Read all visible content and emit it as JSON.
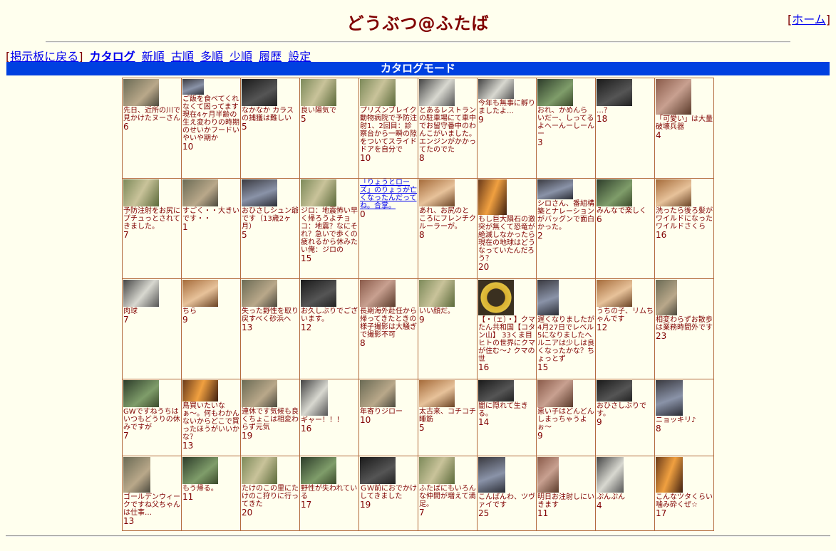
{
  "header": {
    "title": "どうぶつ@ふたば",
    "home_label": "ホーム",
    "bracket_open": "[",
    "bracket_close": "]"
  },
  "nav": {
    "back_label": "掲示板に戻る",
    "bracket_open": "[",
    "bracket_close": "]",
    "current": "カタログ",
    "links": [
      "新順",
      "古順",
      "多順",
      "少順",
      "履歴",
      "設定"
    ]
  },
  "mode_bar": {
    "label": "カタログモード"
  },
  "catalog": {
    "rows": [
      [
        {
          "thumb": [
            50,
            38
          ],
          "style": "t-a",
          "caption": "先日、近所の川で見かけたヌーさん",
          "count": "6"
        },
        {
          "thumb": [
            30,
            22
          ],
          "style": "t-b",
          "caption": "ご飯を食べてくれなくて困ってます現在4ヶ月半齢の生え変わりの時期のせいかフードいやいや期か",
          "count": "10"
        },
        {
          "thumb": [
            50,
            38
          ],
          "style": "t-h",
          "caption": "なかなか カラスの捕獲は難しい",
          "count": "5"
        },
        {
          "thumb": [
            50,
            38
          ],
          "style": "t-c",
          "caption": "良い陽気で",
          "count": "5"
        },
        {
          "thumb": [
            50,
            38
          ],
          "style": "t-c",
          "caption": "プリズンブレイク動物病院で予防注射1、2回目：診察台から一瞬の隙をついてスライドドアを自分で",
          "count": "10"
        },
        {
          "thumb": [
            50,
            38
          ],
          "style": "t-f",
          "caption": "とあるレストランの駐車場にて車中でお留守番中のわんこがいました。エンジンがかかってたのでた",
          "count": "8"
        },
        {
          "thumb": [
            50,
            28
          ],
          "style": "t-f",
          "caption": "今年も無事に孵りましたよ…",
          "count": "9"
        },
        {
          "thumb": [
            50,
            38
          ],
          "style": "t-e",
          "caption": "おれ、かめんらいだー、しってるよへーんーしーんー",
          "count": "3"
        },
        {
          "thumb": [
            50,
            38
          ],
          "style": "t-h",
          "caption": "…？",
          "count": "18"
        },
        {
          "thumb": [
            50,
            50
          ],
          "style": "t-j",
          "caption": "「可愛い」は大量破壊兵器",
          "count": "4"
        }
      ],
      [
        {
          "thumb": [
            50,
            38
          ],
          "style": "t-c",
          "caption": "予防注射をお尻にプチュっとされてきました。",
          "count": "7"
        },
        {
          "thumb": [
            50,
            38
          ],
          "style": "t-a",
          "caption": "すごく・・大きいです・・",
          "count": "1"
        },
        {
          "thumb": [
            50,
            38
          ],
          "style": "t-b",
          "caption": "おひさしシュン爺です（13歳2ヶ月）",
          "count": "5"
        },
        {
          "thumb": [
            50,
            38
          ],
          "style": "t-c",
          "caption": "ジロ：地震怖い早く帰ろうよチョコ：地震？なにそれ？急いで歩くの疲れるから休みたい俺：ジロの",
          "count": "15"
        },
        {
          "thumb": [
            0,
            0
          ],
          "style": "",
          "caption": "「りょうとローズ」のりょうが亡くなったんだってね。合掌。",
          "count": "0",
          "link": true
        },
        {
          "thumb": [
            50,
            38
          ],
          "style": "t-d",
          "caption": "あれ、お尻のところにフレンチクルーラーが。",
          "count": "8"
        },
        {
          "thumb": [
            40,
            50
          ],
          "style": "t-g",
          "caption": "もし巨大隕石の激突が無くて恐竜が絶滅しなかったら現在の地球はどうなっていたんだろう？",
          "count": "20"
        },
        {
          "thumb": [
            50,
            28
          ],
          "style": "t-b",
          "caption": "シロさん、番組構築とナレーションがバッグンで面白かった。",
          "count": "2"
        },
        {
          "thumb": [
            50,
            38
          ],
          "style": "t-e",
          "caption": "みんなで楽しく",
          "count": "6"
        },
        {
          "thumb": [
            50,
            38
          ],
          "style": "t-d",
          "caption": "洗ったら後ろ髪がワイルドになったワイルドさくら",
          "count": "16"
        }
      ],
      [
        {
          "thumb": [
            50,
            38
          ],
          "style": "t-f",
          "caption": "肉球",
          "count": "7"
        },
        {
          "thumb": [
            50,
            38
          ],
          "style": "t-d",
          "caption": "ちら",
          "count": "9"
        },
        {
          "thumb": [
            50,
            38
          ],
          "style": "t-a",
          "caption": "失った野性を取り戻すべく砂浜へ",
          "count": "13"
        },
        {
          "thumb": [
            50,
            38
          ],
          "style": "t-h",
          "caption": "お久しぶりでございます。",
          "count": "12"
        },
        {
          "thumb": [
            50,
            38
          ],
          "style": "t-j",
          "caption": "長期海外赴任から帰ってきたときの様子撮影は大騒ぎで撮影不可",
          "count": "8"
        },
        {
          "thumb": [
            50,
            38
          ],
          "style": "t-c",
          "caption": "いい顔だ。",
          "count": "9"
        },
        {
          "thumb": [
            50,
            50
          ],
          "style": "t-i",
          "caption": "【・（ェ）・】クマたん共和国【コタン山】 33くま目ヒトの世界にクマが住む〜♪ クマの世",
          "count": "16"
        },
        {
          "thumb": [
            30,
            50
          ],
          "style": "t-b",
          "caption": "遅くなりましたが4月27日でレベル5になりましたヘルニアは少しは良くなったかな？ちょっとず",
          "count": "15"
        },
        {
          "thumb": [
            50,
            38
          ],
          "style": "t-d",
          "caption": "うちの子、リムちゃんです",
          "count": "12"
        },
        {
          "thumb": [
            30,
            50
          ],
          "style": "t-a",
          "caption": "相変わらずお散歩は業務時間外です",
          "count": "23"
        }
      ],
      [
        {
          "thumb": [
            50,
            38
          ],
          "style": "t-e",
          "caption": "GWですねうちはいつもどうりの休みですが",
          "count": "7"
        },
        {
          "thumb": [
            50,
            30
          ],
          "style": "t-g",
          "caption": "鳥買いたいなぁ〜。何もわかんないからどこで買ったほうがいいかな？",
          "count": "13"
        },
        {
          "thumb": [
            50,
            38
          ],
          "style": "t-a",
          "caption": "連休です気候も良くちょこは相変わらず元気",
          "count": "19"
        },
        {
          "thumb": [
            38,
            50
          ],
          "style": "t-f",
          "caption": "ギャー！！！",
          "count": "16"
        },
        {
          "thumb": [
            50,
            38
          ],
          "style": "t-a",
          "caption": "年寄りジロー",
          "count": "10"
        },
        {
          "thumb": [
            50,
            38
          ],
          "style": "t-d",
          "caption": "太古来、コチコチ睡筋",
          "count": "5"
        },
        {
          "thumb": [
            50,
            30
          ],
          "style": "t-h",
          "caption": "闇に隠れて生きる。",
          "count": "14"
        },
        {
          "thumb": [
            50,
            38
          ],
          "style": "t-j",
          "caption": "悪い子はどんどんしまっちゃうよぉ〜",
          "count": "9"
        },
        {
          "thumb": [
            50,
            30
          ],
          "style": "t-h",
          "caption": "おひさしぶりです。",
          "count": "9"
        },
        {
          "thumb": [
            38,
            50
          ],
          "style": "t-b",
          "caption": "ニョッキリ♪",
          "count": "8"
        }
      ],
      [
        {
          "thumb": [
            38,
            50
          ],
          "style": "t-a",
          "caption": "ゴールデンウィークですね父ちゃんは仕事…",
          "count": "13"
        },
        {
          "thumb": [
            50,
            38
          ],
          "style": "t-e",
          "caption": "もう帰る。",
          "count": "11"
        },
        {
          "thumb": [
            50,
            38
          ],
          "style": "t-c",
          "caption": "たけのこの里にたけのこ狩りに行ってきた",
          "count": "20"
        },
        {
          "thumb": [
            50,
            38
          ],
          "style": "t-e",
          "caption": "野性が失われている",
          "count": "17"
        },
        {
          "thumb": [
            50,
            38
          ],
          "style": "t-h",
          "caption": "ＧＷ前におでかけしてきました",
          "count": "19"
        },
        {
          "thumb": [
            50,
            38
          ],
          "style": "t-c",
          "caption": "ふたばにもいろんな仲間が増えて満足。",
          "count": "7"
        },
        {
          "thumb": [
            38,
            50
          ],
          "style": "t-b",
          "caption": "こんばんわ、ツヴァイです",
          "count": "25"
        },
        {
          "thumb": [
            30,
            50
          ],
          "style": "t-j",
          "caption": "明日お注射しにいきます",
          "count": "11"
        },
        {
          "thumb": [
            38,
            50
          ],
          "style": "t-f",
          "caption": "ぷんぷん",
          "count": "4"
        },
        {
          "thumb": [
            38,
            50
          ],
          "style": "t-g",
          "caption": "こんなツタくらい噛み砕くぜ☆",
          "count": "17"
        }
      ]
    ]
  }
}
